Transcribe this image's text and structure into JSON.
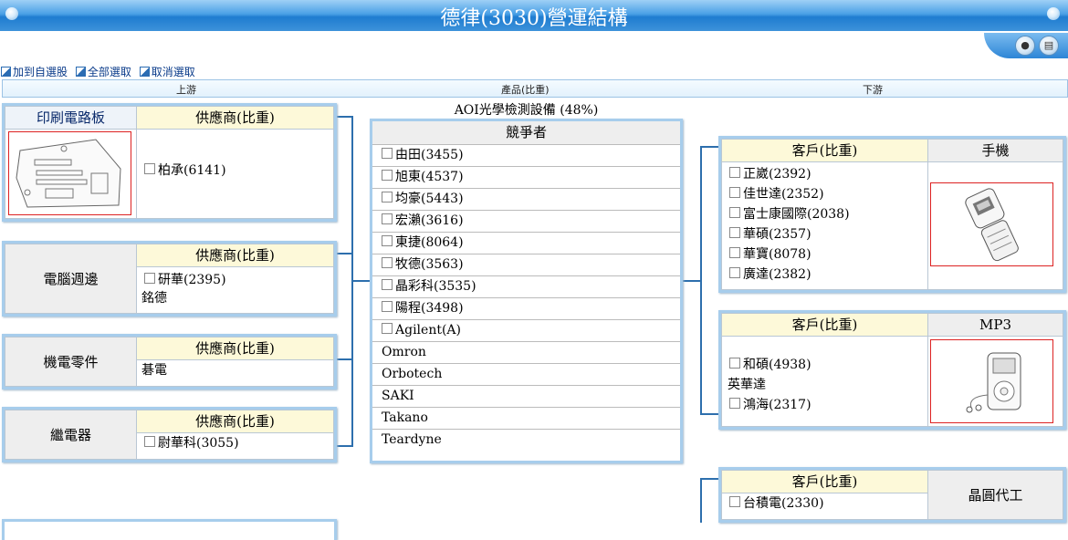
{
  "page": {
    "title": "德律(3030)營運結構"
  },
  "toolbar": {
    "lock_icon": "lock-icon",
    "print_icon": "printer-icon"
  },
  "actions": [
    {
      "label": "加到自選股"
    },
    {
      "label": "全部選取"
    },
    {
      "label": "取消選取"
    }
  ],
  "columns": {
    "upstream": "上游",
    "product": "產品(比重)",
    "downstream": "下游"
  },
  "upstream": [
    {
      "category": "印刷電路板",
      "header": "供應商(比重)",
      "has_image": true,
      "image_icon": "pcb-board-icon",
      "items": [
        {
          "label": "柏承(6141)",
          "checkbox": true
        }
      ]
    },
    {
      "category": "電腦週邊",
      "header": "供應商(比重)",
      "items": [
        {
          "label": "研華(2395)",
          "checkbox": true
        },
        {
          "label": "銘德",
          "checkbox": false
        }
      ]
    },
    {
      "category": "機電零件",
      "header": "供應商(比重)",
      "items": [
        {
          "label": "碁電",
          "checkbox": false
        }
      ]
    },
    {
      "category": "繼電器",
      "header": "供應商(比重)",
      "items": [
        {
          "label": "尉華科(3055)",
          "checkbox": true
        }
      ]
    }
  ],
  "product": {
    "name": "AOI光學檢測設備 (48%)",
    "header": "競爭者",
    "competitors": [
      {
        "label": "由田(3455)",
        "checkbox": true
      },
      {
        "label": "旭東(4537)",
        "checkbox": true
      },
      {
        "label": "均豪(5443)",
        "checkbox": true
      },
      {
        "label": "宏瀨(3616)",
        "checkbox": true
      },
      {
        "label": "東捷(8064)",
        "checkbox": true
      },
      {
        "label": "牧德(3563)",
        "checkbox": true
      },
      {
        "label": "晶彩科(3535)",
        "checkbox": true
      },
      {
        "label": "陽程(3498)",
        "checkbox": true
      },
      {
        "label": "Agilent(A)",
        "checkbox": true
      },
      {
        "label": "Omron",
        "checkbox": false
      },
      {
        "label": "Orbotech",
        "checkbox": false
      },
      {
        "label": "SAKI",
        "checkbox": false
      },
      {
        "label": "Takano",
        "checkbox": false
      },
      {
        "label": "Teardyne",
        "checkbox": false
      }
    ]
  },
  "downstream": [
    {
      "header": "客戶(比重)",
      "category": "手機",
      "image_icon": "flip-phone-icon",
      "items": [
        {
          "label": "正崴(2392)",
          "checkbox": true
        },
        {
          "label": "佳世達(2352)",
          "checkbox": true
        },
        {
          "label": "富士康國際(2038)",
          "checkbox": true
        },
        {
          "label": "華碩(2357)",
          "checkbox": true
        },
        {
          "label": "華寶(8078)",
          "checkbox": true
        },
        {
          "label": "廣達(2382)",
          "checkbox": true
        }
      ]
    },
    {
      "header": "客戶(比重)",
      "category": "MP3",
      "image_icon": "mp3-player-icon",
      "items": [
        {
          "label": "和碩(4938)",
          "checkbox": true
        },
        {
          "label": "英華達",
          "checkbox": false
        },
        {
          "label": "鴻海(2317)",
          "checkbox": true
        }
      ]
    },
    {
      "header": "客戶(比重)",
      "category": "晶圓代工",
      "items": [
        {
          "label": "台積電(2330)",
          "checkbox": true
        }
      ]
    }
  ]
}
